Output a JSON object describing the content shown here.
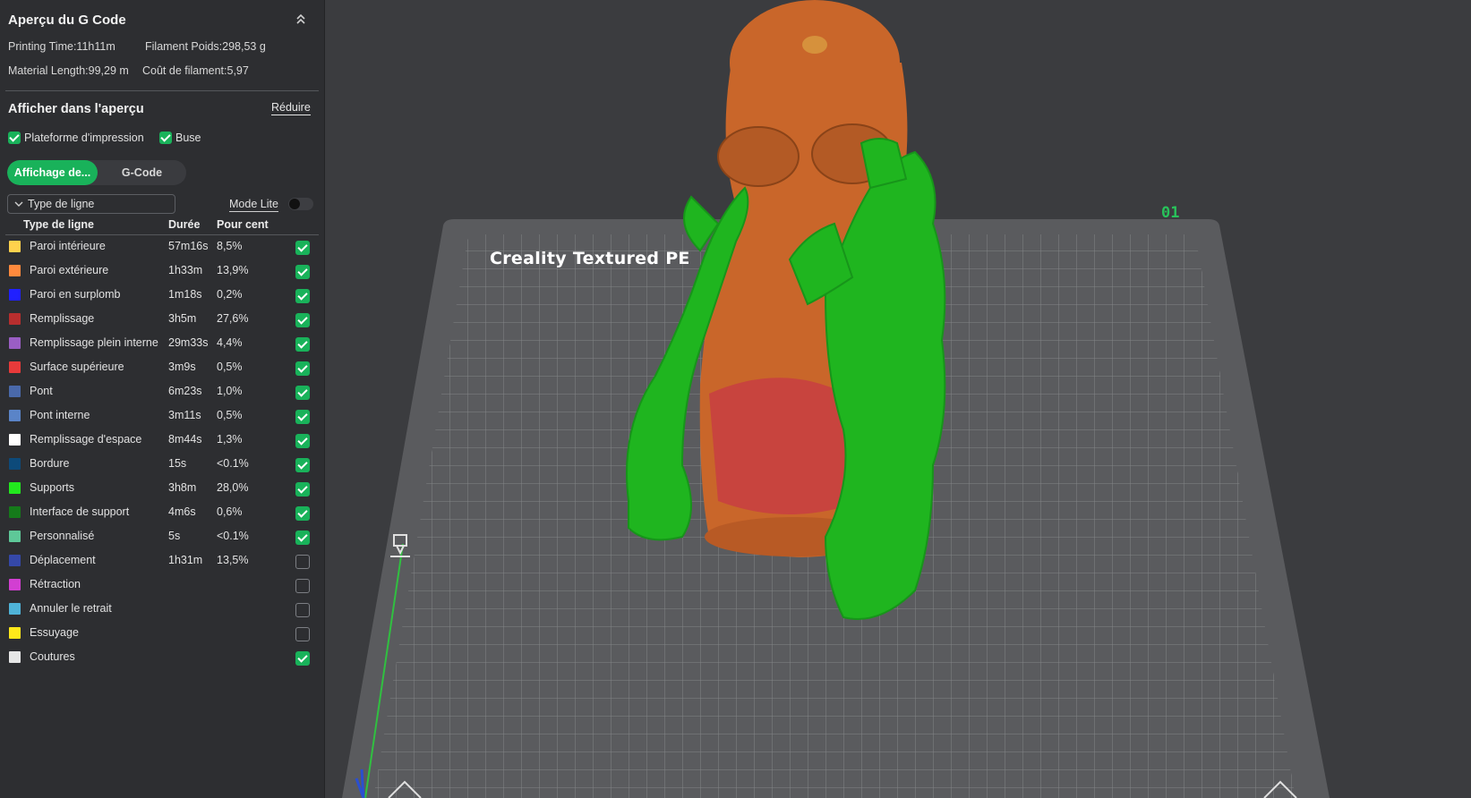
{
  "panel": {
    "title": "Aperçu du G Code",
    "collapse_icon": "double-chevron-up-icon",
    "stats": {
      "printing_time": "Printing Time:11h11m",
      "filament_weight": "Filament Poids:298,53 g",
      "material_length": "Material Length:99,29 m",
      "filament_cost": "Coût de filament:5,97"
    },
    "show_section": {
      "title": "Afficher dans l'aperçu",
      "reduce_label": "Réduire",
      "options": [
        {
          "label": "Plateforme d'impression",
          "checked": true
        },
        {
          "label": "Buse",
          "checked": true
        }
      ]
    },
    "tabs": [
      {
        "label": "Affichage de...",
        "active": true
      },
      {
        "label": "G-Code",
        "active": false
      }
    ],
    "view_dropdown": {
      "value": "Type de ligne",
      "icon": "chevron-down-icon"
    },
    "mode_lite": {
      "label": "Mode Lite",
      "enabled": false
    },
    "table": {
      "headers": [
        "Type de ligne",
        "Durée",
        "Pour cent"
      ],
      "rows": [
        {
          "name": "Paroi intérieure",
          "duration": "57m16s",
          "percent": "8,5%",
          "color": "#ffd24d",
          "visible": true
        },
        {
          "name": "Paroi extérieure",
          "duration": "1h33m",
          "percent": "13,9%",
          "color": "#ff8a3d",
          "visible": true
        },
        {
          "name": "Paroi en surplomb",
          "duration": "1m18s",
          "percent": "0,2%",
          "color": "#2020ff",
          "visible": true
        },
        {
          "name": "Remplissage",
          "duration": "3h5m",
          "percent": "27,6%",
          "color": "#b82e2e",
          "visible": true
        },
        {
          "name": "Remplissage plein interne",
          "duration": "29m33s",
          "percent": "4,4%",
          "color": "#9a5ec4",
          "visible": true
        },
        {
          "name": "Surface supérieure",
          "duration": "3m9s",
          "percent": "0,5%",
          "color": "#e83a3a",
          "visible": true
        },
        {
          "name": "Pont",
          "duration": "6m23s",
          "percent": "1,0%",
          "color": "#4a69aa",
          "visible": true
        },
        {
          "name": "Pont interne",
          "duration": "3m11s",
          "percent": "0,5%",
          "color": "#5a84c8",
          "visible": true
        },
        {
          "name": "Remplissage d'espace",
          "duration": "8m44s",
          "percent": "1,3%",
          "color": "#ffffff",
          "visible": true
        },
        {
          "name": "Bordure",
          "duration": "15s",
          "percent": "<0.1%",
          "color": "#0d4a7a",
          "visible": true
        },
        {
          "name": "Supports",
          "duration": "3h8m",
          "percent": "28,0%",
          "color": "#22e81e",
          "visible": true
        },
        {
          "name": "Interface de support",
          "duration": "4m6s",
          "percent": "0,6%",
          "color": "#157a1a",
          "visible": true
        },
        {
          "name": "Personnalisé",
          "duration": "5s",
          "percent": "<0.1%",
          "color": "#5ec898",
          "visible": true
        },
        {
          "name": "Déplacement",
          "duration": "1h31m",
          "percent": "13,5%",
          "color": "#3548a8",
          "visible": false
        },
        {
          "name": "Rétraction",
          "duration": "",
          "percent": "",
          "color": "#d23fd2",
          "visible": false
        },
        {
          "name": "Annuler le retrait",
          "duration": "",
          "percent": "",
          "color": "#4fb3d8",
          "visible": false
        },
        {
          "name": "Essuyage",
          "duration": "",
          "percent": "",
          "color": "#ffe81a",
          "visible": false
        },
        {
          "name": "Coutures",
          "duration": "",
          "percent": "",
          "color": "#e6e6e6",
          "visible": true
        }
      ]
    }
  },
  "viewport": {
    "plate_label": "Creality Textured PE",
    "plate_number": "01",
    "colors": {
      "background": "#3b3c3f",
      "plate": "#5a5b5e",
      "grid": "#8a8b8e",
      "model": "#c9662a",
      "supports": "#1fb51f"
    }
  }
}
